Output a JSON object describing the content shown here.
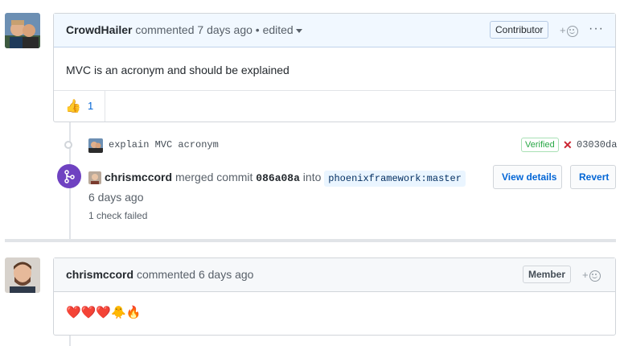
{
  "comment1": {
    "author": "CrowdHailer",
    "action": "commented 7 days ago",
    "edited": "• edited",
    "badge": "Contributor",
    "add_reaction": "+",
    "more": "···",
    "body": "MVC is an acronym and should be explained",
    "reaction": {
      "emoji": "👍",
      "count": "1"
    }
  },
  "commit": {
    "message": "explain MVC acronym",
    "verified": "Verified",
    "status_icon": "✕",
    "sha": "03030da"
  },
  "merge": {
    "author": "chrismccord",
    "text_merged": "merged commit",
    "sha": "086a08a",
    "text_into": "into",
    "branch": "phoenixframework:master",
    "time": "6 days ago",
    "checks": "1 check failed",
    "view_details": "View details",
    "revert": "Revert"
  },
  "comment2": {
    "author": "chrismccord",
    "action": "commented 6 days ago",
    "badge": "Member",
    "add_reaction": "+",
    "body": "❤️❤️❤️🐥🔥"
  },
  "colors": {
    "accent": "#0366d6",
    "merged": "#6f42c1",
    "fail": "#cb2431",
    "verified": "#28a745"
  }
}
